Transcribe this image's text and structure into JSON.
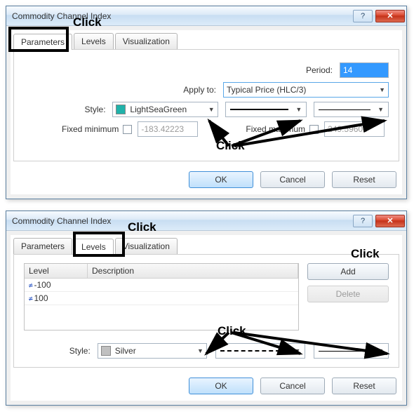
{
  "dialog1": {
    "title": "Commodity Channel Index",
    "tabs": [
      "Parameters",
      "Levels",
      "Visualization"
    ],
    "active_tab": 0,
    "period_label": "Period:",
    "period_value": "14",
    "apply_label": "Apply to:",
    "apply_value": "Typical Price (HLC/3)",
    "style_label": "Style:",
    "style_color_name": "LightSeaGreen",
    "style_color_hex": "#20b2aa",
    "fixed_min_label": "Fixed minimum",
    "fixed_min_value": "-183.42223",
    "fixed_max_label": "Fixed maximum",
    "fixed_max_value": "249.59606",
    "ok": "OK",
    "cancel": "Cancel",
    "reset": "Reset"
  },
  "dialog2": {
    "title": "Commodity Channel Index",
    "tabs": [
      "Parameters",
      "Levels",
      "Visualization"
    ],
    "active_tab": 1,
    "col_level": "Level",
    "col_desc": "Description",
    "rows": [
      {
        "level": "-100",
        "desc": ""
      },
      {
        "level": "100",
        "desc": ""
      }
    ],
    "add": "Add",
    "delete": "Delete",
    "style_label": "Style:",
    "style_color_name": "Silver",
    "style_color_hex": "#c0c0c0",
    "ok": "OK",
    "cancel": "Cancel",
    "reset": "Reset"
  },
  "annotations": {
    "click1": "Click",
    "click2": "Click",
    "click3": "Click",
    "click4": "Click",
    "click5": "Click"
  }
}
